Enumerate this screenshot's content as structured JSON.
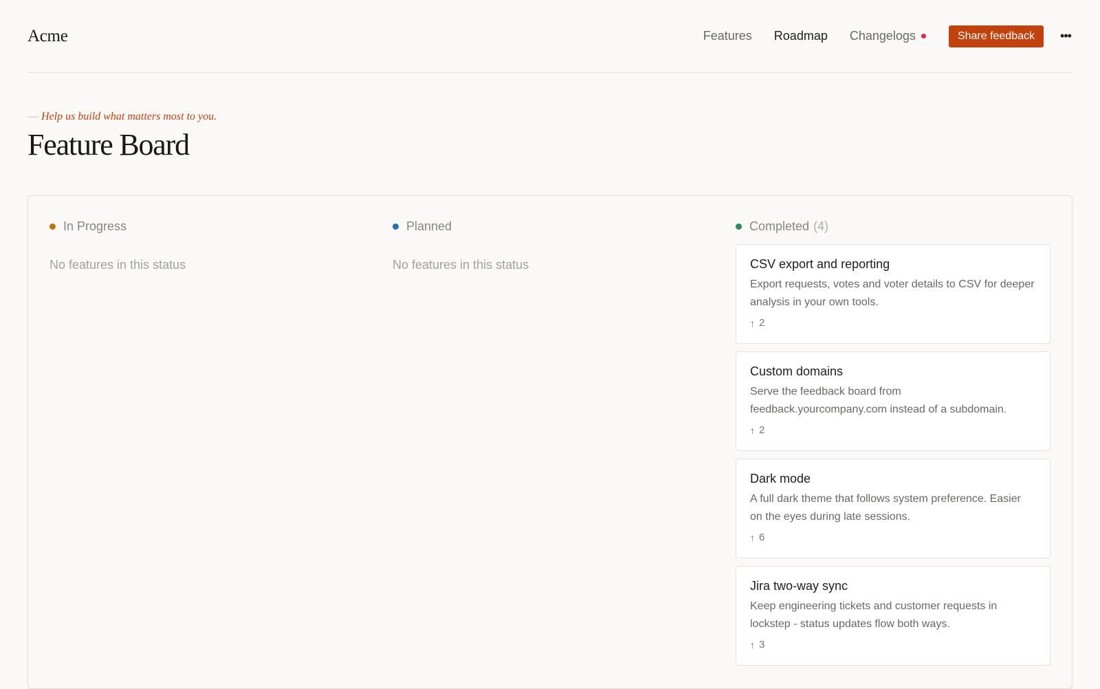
{
  "header": {
    "brand": "Acme",
    "nav": [
      {
        "label": "Features",
        "active": false
      },
      {
        "label": "Roadmap",
        "active": true
      },
      {
        "label": "Changelogs",
        "active": false,
        "has_notification": true
      }
    ],
    "share_label": "Share feedback",
    "more_icon": "ellipsis-icon"
  },
  "hero": {
    "tagline_dash": "—",
    "tagline": "Help us build what matters most to you.",
    "title": "Feature Board"
  },
  "columns": [
    {
      "label": "In Progress",
      "color": "#c2720c",
      "count": "",
      "empty_text": "No features in this status"
    },
    {
      "label": "Planned",
      "color": "#2f6ea8",
      "count": "",
      "empty_text": "No features in this status"
    },
    {
      "label": "Completed",
      "color": "#2e8b5f",
      "count": "(4)",
      "empty_text": ""
    }
  ],
  "completed_cards": [
    {
      "title": "CSV export and reporting",
      "description": "Export requests, votes and voter details to CSV for deeper analysis in your own tools.",
      "votes": "2"
    },
    {
      "title": "Custom domains",
      "description": "Serve the feedback board from feedback.yourcompany.com instead of a subdomain.",
      "votes": "2"
    },
    {
      "title": "Dark mode",
      "description": "A full dark theme that follows system preference. Easier on the eyes during late sessions.",
      "votes": "6"
    },
    {
      "title": "Jira two-way sync",
      "description": "Keep engineering tickets and customer requests in lockstep - status updates flow both ways.",
      "votes": "3"
    }
  ],
  "colors": {
    "accent": "#c2410c",
    "notification": "#e5294a",
    "background": "#faf9f7"
  }
}
